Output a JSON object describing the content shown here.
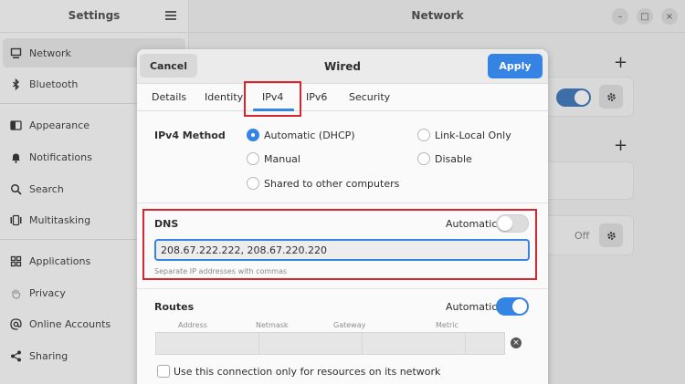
{
  "sidebar": {
    "title": "Settings",
    "items": [
      {
        "label": "Network",
        "icon": "monitor-icon"
      },
      {
        "label": "Bluetooth",
        "icon": "bluetooth-icon"
      },
      {
        "label": "Appearance",
        "icon": "appearance-icon"
      },
      {
        "label": "Notifications",
        "icon": "bell-icon"
      },
      {
        "label": "Search",
        "icon": "search-icon"
      },
      {
        "label": "Multitasking",
        "icon": "multitasking-icon"
      },
      {
        "label": "Applications",
        "icon": "grid-icon"
      },
      {
        "label": "Privacy",
        "icon": "hand-icon"
      },
      {
        "label": "Online Accounts",
        "icon": "at-icon"
      },
      {
        "label": "Sharing",
        "icon": "share-icon"
      }
    ]
  },
  "main": {
    "title": "Network",
    "off_label": "Off"
  },
  "dialog": {
    "title": "Wired",
    "cancel_label": "Cancel",
    "apply_label": "Apply",
    "tabs": [
      "Details",
      "Identity",
      "IPv4",
      "IPv6",
      "Security"
    ],
    "active_tab": "IPv4",
    "ipv4_method": {
      "label": "IPv4 Method",
      "options": [
        "Automatic (DHCP)",
        "Link-Local Only",
        "Manual",
        "Disable",
        "Shared to other computers"
      ],
      "selected": "Automatic (DHCP)"
    },
    "dns": {
      "label": "DNS",
      "automatic_label": "Automatic",
      "automatic_on": false,
      "value": "208.67.222.222, 208.67.220.220",
      "hint": "Separate IP addresses with commas"
    },
    "routes": {
      "label": "Routes",
      "automatic_label": "Automatic",
      "automatic_on": true,
      "columns": [
        "Address",
        "Netmask",
        "Gateway",
        "Metric"
      ]
    },
    "only_resources_label": "Use this connection only for resources on its network"
  },
  "colors": {
    "accent": "#3584e4",
    "highlight": "#d9262e"
  }
}
